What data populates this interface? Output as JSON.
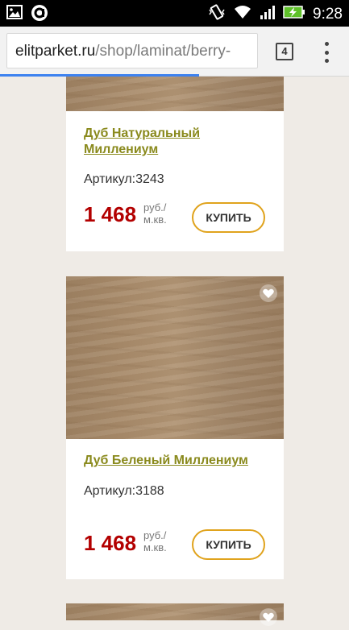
{
  "status_bar": {
    "time": "9:28",
    "left_icons": [
      "gallery-icon",
      "app-notification-icon"
    ],
    "right_icons": [
      "vibrate-icon",
      "wifi-icon",
      "signal-icon",
      "battery-charging-icon"
    ]
  },
  "browser": {
    "url_host": "elitparket.ru",
    "url_path": "/shop/laminat/berry-",
    "tab_count": "4",
    "load_progress": 0.57
  },
  "products": [
    {
      "name": "Дуб Натуральный Миллениум",
      "sku": "Артикул:3243",
      "price": "1 468",
      "unit": "руб./ м.кв.",
      "buy_label": "КУПИТЬ"
    },
    {
      "name": "Дуб Беленый Миллениум",
      "sku": "Артикул:3188",
      "price": "1 468",
      "unit": "руб./ м.кв.",
      "buy_label": "КУПИТЬ"
    }
  ],
  "colors": {
    "background": "#efebe6",
    "product_link": "#8a8a1d",
    "price": "#b30000",
    "button_border": "#e0a31d",
    "progress": "#3d82f0"
  }
}
